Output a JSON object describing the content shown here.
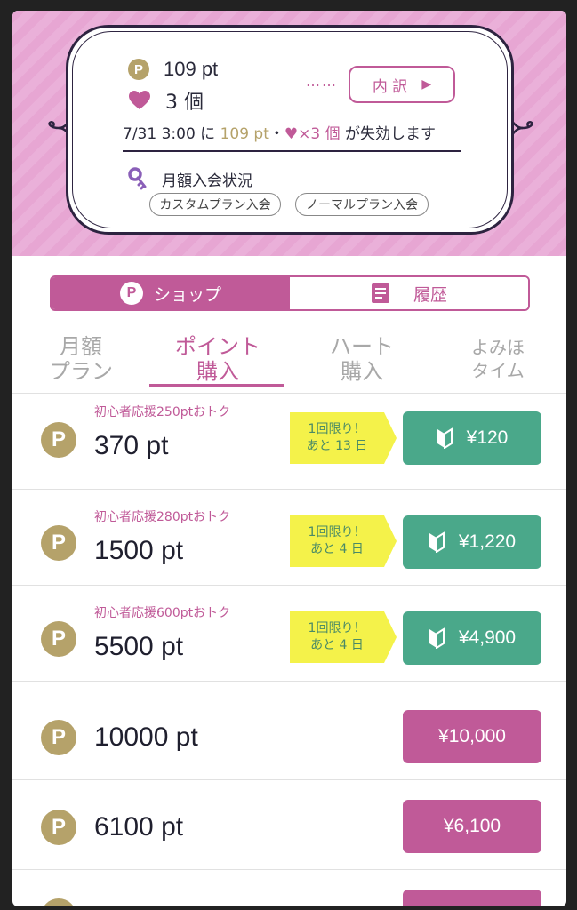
{
  "header": {
    "points": "109 pt",
    "hearts": "3 個",
    "coin_letter": "P",
    "dots": "……",
    "breakdown_label": "内 訳",
    "breakdown_arrow": "▶",
    "expire_prefix": "7/31 3:00 に ",
    "expire_points": "109 pt",
    "expire_sep": "・",
    "expire_hearts": "♥×3 個",
    "expire_suffix": " が失効します",
    "membership_title": "月額入会状況",
    "custom_plan": "カスタムプラン入会",
    "normal_plan": "ノーマルプラン入会"
  },
  "segment": {
    "shop": "ショップ",
    "history": "履歴",
    "coin_letter": "P"
  },
  "subtabs": {
    "monthly_l1": "月額",
    "monthly_l2": "プラン",
    "points_l1": "ポイント",
    "points_l2": "購入",
    "heart_l1": "ハート",
    "heart_l2": "購入",
    "yomiho_l1": "よみほ",
    "yomiho_l2": "タイム"
  },
  "rows": [
    {
      "promo": "初心者応援250ptおトク",
      "points": "370 pt",
      "limit_l1": "1回限り！",
      "limit_l2": "あと 13 日",
      "price": "¥120"
    },
    {
      "promo": "初心者応援280ptおトク",
      "points": "1500 pt",
      "limit_l1": "1回限り！",
      "limit_l2": "あと 4 日",
      "price": "¥1,220"
    },
    {
      "promo": "初心者応援600ptおトク",
      "points": "5500 pt",
      "limit_l1": "1回限り！",
      "limit_l2": "あと 4 日",
      "price": "¥4,900"
    },
    {
      "points": "10000 pt",
      "price": "¥10,000"
    },
    {
      "points": "6100 pt",
      "price": "¥6,100"
    }
  ],
  "colors": {
    "accent": "#c05a98",
    "gold": "#b5a26a",
    "green": "#4aa88a",
    "limit_tag": "#f4f24a"
  }
}
